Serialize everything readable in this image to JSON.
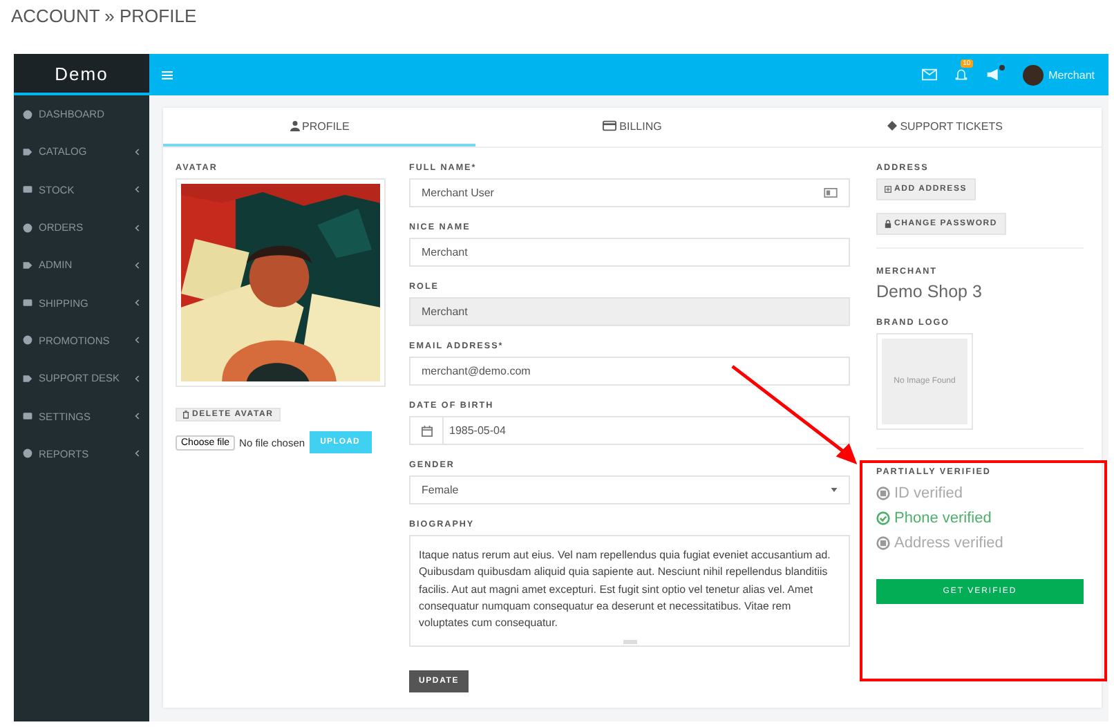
{
  "breadcrumb": "ACCOUNT » PROFILE",
  "brand": "Demo",
  "topbar": {
    "notification_count": "10",
    "announcement_unread": true,
    "user_name": "Merchant"
  },
  "sidebar": {
    "items": [
      {
        "label": "DASHBOARD",
        "has_submenu": false
      },
      {
        "label": "CATALOG",
        "has_submenu": true
      },
      {
        "label": "STOCK",
        "has_submenu": true
      },
      {
        "label": "ORDERS",
        "has_submenu": true
      },
      {
        "label": "ADMIN",
        "has_submenu": true
      },
      {
        "label": "SHIPPING",
        "has_submenu": true
      },
      {
        "label": "PROMOTIONS",
        "has_submenu": true
      },
      {
        "label": "SUPPORT DESK",
        "has_submenu": true
      },
      {
        "label": "SETTINGS",
        "has_submenu": true
      },
      {
        "label": "REPORTS",
        "has_submenu": true
      }
    ]
  },
  "tabs": [
    {
      "label": "PROFILE",
      "selected": true
    },
    {
      "label": "BILLING",
      "selected": false
    },
    {
      "label": "SUPPORT TICKETS",
      "selected": false
    }
  ],
  "avatar": {
    "label": "AVATAR",
    "delete_button": "DELETE AVATAR",
    "choose_file_button": "Choose file",
    "file_status": "No file chosen",
    "upload_button": "UPLOAD"
  },
  "fields": [
    {
      "kind": "text",
      "label": "FULL NAME*",
      "value": "Merchant User"
    },
    {
      "kind": "plain",
      "label": "NICE NAME",
      "value": "Merchant"
    },
    {
      "kind": "readonly",
      "label": "ROLE",
      "value": "Merchant"
    },
    {
      "kind": "plain",
      "label": "EMAIL ADDRESS*",
      "value": "merchant@demo.com"
    },
    {
      "kind": "date",
      "label": "DATE OF BIRTH",
      "value": "1985-05-04"
    },
    {
      "kind": "select",
      "label": "GENDER",
      "value": "Female"
    },
    {
      "kind": "textarea",
      "label": "BIOGRAPHY",
      "value": "Itaque natus rerum aut eius. Vel nam repellendus quia fugiat eveniet accusantium ad. Quibusdam quibusdam aliquid quia sapiente aut. Nesciunt nihil repellendus blanditiis facilis. Aut aut magni amet excepturi. Est fugit sint optio vel tenetur alias vel. Amet consequatur numquam consequatur ea deserunt et necessitatibus. Vitae rem voluptates cum consequatur."
    }
  ],
  "update_button": "UPDATE",
  "address": {
    "label": "ADDRESS",
    "add_button": "ADD ADDRESS",
    "password_button": "CHANGE PASSWORD"
  },
  "merchant": {
    "label": "MERCHANT",
    "shop_name": "Demo Shop 3"
  },
  "brand_logo": {
    "label": "BRAND LOGO",
    "placeholder_text": "No Image Found"
  },
  "verification": {
    "status": "PARTIALLY VERIFIED",
    "items": [
      {
        "label": "ID verified",
        "verified": false
      },
      {
        "label": "Phone verified",
        "verified": true
      },
      {
        "label": "Address verified",
        "verified": false
      }
    ],
    "button": "GET VERIFIED"
  }
}
